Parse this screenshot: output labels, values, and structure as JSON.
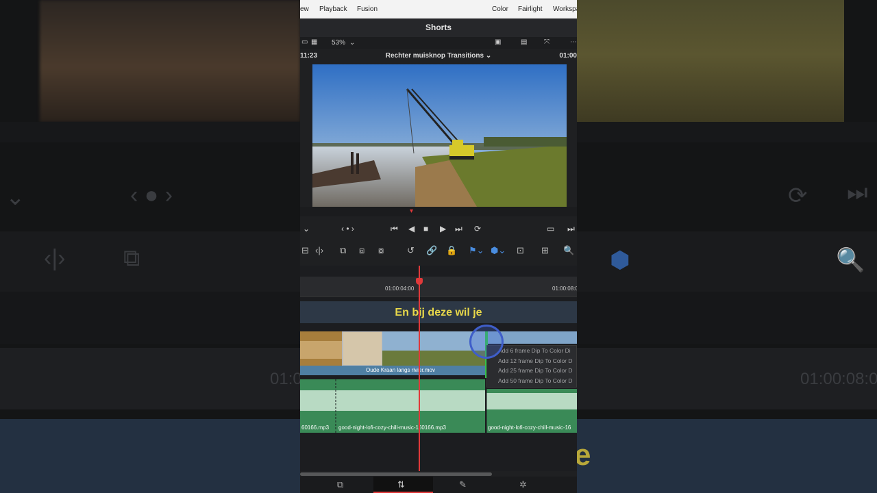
{
  "menubar": {
    "items": [
      "ew",
      "Playback",
      "Fusion",
      "Color",
      "Fairlight",
      "Workspa"
    ]
  },
  "project": {
    "title": "Shorts"
  },
  "viewer": {
    "zoom": "53%",
    "timecode_left": "11:23",
    "clip_name": "Rechter muisknop Transitions",
    "timecode_right": "01:00"
  },
  "timeline": {
    "ruler_labels": [
      "01:00:04:00",
      "01:00:08:0"
    ],
    "subtitle": "En bij deze wil je",
    "video_clip_name": "Oude Kraan langs rivier.mov",
    "audio_clips": [
      "60166.mp3",
      "good-night-lofi-cozy-chill-music-160166.mp3",
      "good-night-lofi-cozy-chill-music-16"
    ]
  },
  "context_menu": {
    "items": [
      "Add 6 frame Dip To Color Di",
      "Add 12 frame Dip To Color D",
      "Add 25 frame Dip To Color D",
      "Add 50 frame Dip To Color D"
    ]
  },
  "background": {
    "timecodes": [
      "01:0",
      "01:00:08:0"
    ],
    "subtitle_fragment": "e"
  },
  "colors": {
    "accent_red": "#e0393a",
    "subtitle_yellow": "#e8d84a",
    "clip_blue": "#4f7fa3",
    "audio_green": "#3a8a57"
  }
}
